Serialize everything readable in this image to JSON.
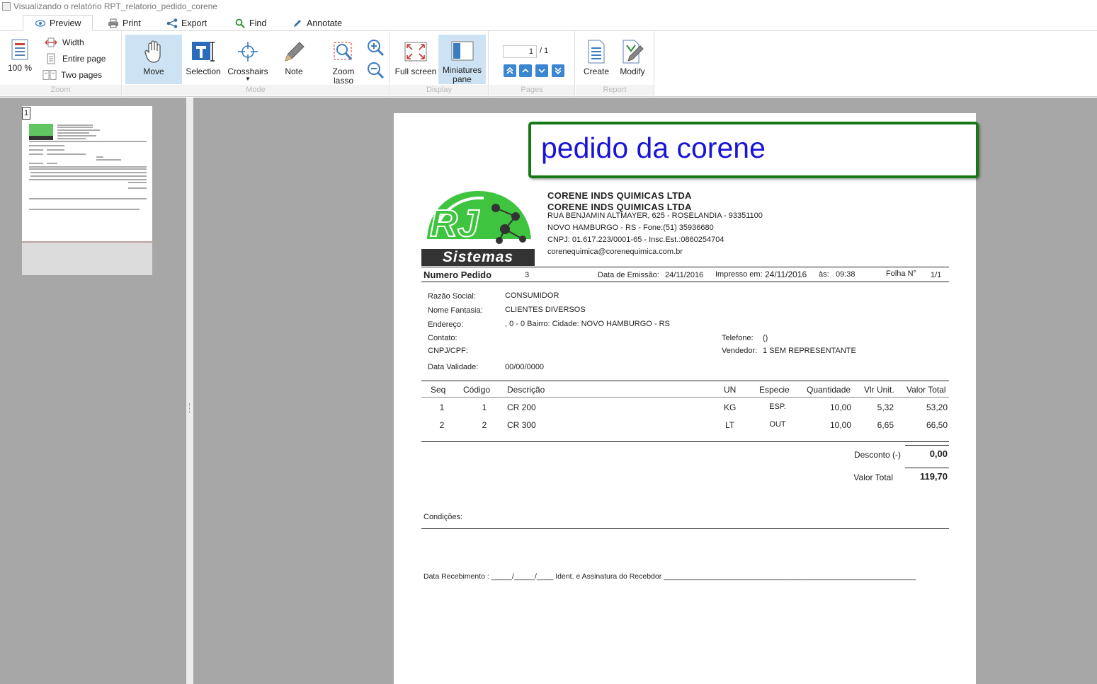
{
  "window": {
    "title": "Visualizando o relatório RPT_relatorio_pedido_corene"
  },
  "tabs": [
    {
      "label": "Preview",
      "active": true
    },
    {
      "label": "Print"
    },
    {
      "label": "Export"
    },
    {
      "label": "Find"
    },
    {
      "label": "Annotate"
    }
  ],
  "ribbon": {
    "zoom": {
      "percent": "100 %",
      "width": "Width",
      "entire_page": "Entire page",
      "two_pages": "Two pages",
      "group": "Zoom"
    },
    "mode": {
      "move": "Move",
      "selection": "Selection",
      "crosshairs": "Crosshairs",
      "note": "Note",
      "zoom_lasso": "Zoom lasso",
      "group": "Mode"
    },
    "display": {
      "full_screen": "Full screen",
      "miniatures": "Miniatures pane",
      "group": "Display"
    },
    "pages": {
      "current": "1",
      "of": "/ 1",
      "group": "Pages"
    },
    "report": {
      "create": "Create",
      "modify": "Modify",
      "group": "Report"
    }
  },
  "thumbnail": {
    "number": "1"
  },
  "report": {
    "title": "pedido da corene",
    "logo_text": "Sistemas",
    "logo_letters": "RJ",
    "company": {
      "name1": "CORENE INDS QUIMICAS LTDA",
      "name2": "CORENE INDS QUIMICAS LTDA",
      "address": "RUA BENJAMIN ALTMAYER, 625 - ROSELANDIA -  93351100",
      "city": "NOVO HAMBURGO  -  RS - Fone:(51) 35936680",
      "cnpj": "CNPJ: 01.617.223/0001-65 - Insc.Est.:0860254704",
      "email": "corenequimica@corenequimica.com.br"
    },
    "header": {
      "numero_label": "Numero Pedido",
      "numero": "3",
      "emissao_label": "Data de Emissão:",
      "emissao": "24/11/2016",
      "impresso_label": "Impresso em:",
      "impresso": "24/11/2016",
      "as_label": "às:",
      "hora": "09:38",
      "folha_label": "Folha N°",
      "folha": "1/1"
    },
    "client": {
      "razao_label": "Razão Social:",
      "razao": "CONSUMIDOR",
      "fantasia_label": "Nome Fantasia:",
      "fantasia": "CLIENTES DIVERSOS",
      "endereco_label": "Endereço:",
      "endereco": ", 0 - 0 Bairro:  Cidade: NOVO HAMBURGO - RS",
      "contato_label": "Contato:",
      "cnpj_label": "CNPJ/CPF:",
      "telefone_label": "Telefone:",
      "telefone": "()",
      "vendedor_label": "Vendedor:",
      "vendedor": "1  SEM REPRESENTANTE",
      "validade_label": "Data Validade:",
      "validade": "00/00/0000"
    },
    "table": {
      "headers": [
        "Seq",
        "Código",
        "Descrição",
        "UN",
        "Especie",
        "Quantidade",
        "Vlr Unit.",
        "Valor Total"
      ],
      "rows": [
        [
          "1",
          "1",
          "CR 200",
          "KG",
          "ESP.",
          "10,00",
          "5,32",
          "53,20"
        ],
        [
          "2",
          "2",
          "CR 300",
          "LT",
          "OUT",
          "10,00",
          "6,65",
          "66,50"
        ]
      ]
    },
    "totals": {
      "desconto_label": "Desconto (-)",
      "desconto": "0,00",
      "total_label": "Valor Total",
      "total": "119,70"
    },
    "condicoes_label": "Condições:",
    "recebimento": "Data Recebimento : _____/_____/____ Ident. e Assinatura do Recebdor _____________________________________________________________"
  }
}
